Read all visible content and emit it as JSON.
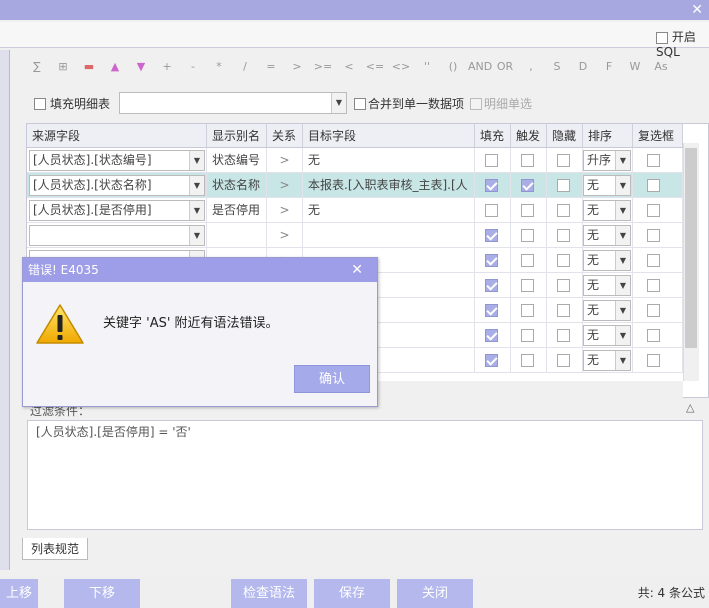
{
  "window": {
    "close_glyph": "✕"
  },
  "sql_toggle": {
    "label": "开启SQL"
  },
  "toolbar": {
    "buttons": [
      "sigma-icon",
      "table-add-icon",
      "table-remove-icon",
      "up-arrow-icon",
      "down-arrow-icon",
      "+",
      "-",
      "*",
      "/",
      "=",
      ">",
      ">=",
      "<",
      "<=",
      "<>",
      "''",
      "()",
      "AND",
      "OR",
      ",",
      "S",
      "D",
      "F",
      "W",
      "As"
    ]
  },
  "options": {
    "fill_detail": "填充明细表",
    "merge_single": "合并到单一数据项",
    "detail_single": "明细单选"
  },
  "grid": {
    "headers": [
      "来源字段",
      "显示别名",
      "关系",
      "目标字段",
      "填充",
      "触发",
      "隐藏",
      "排序",
      "复选框"
    ],
    "rows": [
      {
        "source": "[人员状态].[状态编号]",
        "alias": "状态编号",
        "rel": ">",
        "target": "无",
        "fill": false,
        "trigger": false,
        "hide": false,
        "sort": "升序",
        "check": false,
        "selected": false
      },
      {
        "source": "[人员状态].[状态名称]",
        "alias": "状态名称",
        "rel": ">",
        "target": "本报表.[入职表审核_主表].[人",
        "fill": true,
        "trigger": true,
        "hide": false,
        "sort": "无",
        "check": false,
        "selected": true
      },
      {
        "source": "[人员状态].[是否停用]",
        "alias": "是否停用",
        "rel": ">",
        "target": "无",
        "fill": false,
        "trigger": false,
        "hide": false,
        "sort": "无",
        "check": false,
        "selected": false
      },
      {
        "source": "",
        "alias": "",
        "rel": ">",
        "target": "",
        "fill": true,
        "trigger": false,
        "hide": false,
        "sort": "无",
        "check": false,
        "selected": false
      },
      {
        "source": "",
        "alias": "",
        "rel": ">",
        "target": "",
        "fill": true,
        "trigger": false,
        "hide": false,
        "sort": "无",
        "check": false,
        "selected": false
      },
      {
        "source": "",
        "alias": "",
        "rel": ">",
        "target": "",
        "fill": true,
        "trigger": false,
        "hide": false,
        "sort": "无",
        "check": false,
        "selected": false
      },
      {
        "source": "",
        "alias": "",
        "rel": ">",
        "target": "",
        "fill": true,
        "trigger": false,
        "hide": false,
        "sort": "无",
        "check": false,
        "selected": false
      },
      {
        "source": "",
        "alias": "",
        "rel": ">",
        "target": "",
        "fill": true,
        "trigger": false,
        "hide": false,
        "sort": "无",
        "check": false,
        "selected": false
      },
      {
        "source": "",
        "alias": "",
        "rel": ">",
        "target": "",
        "fill": true,
        "trigger": false,
        "hide": false,
        "sort": "无",
        "check": false,
        "selected": false
      }
    ]
  },
  "filter": {
    "label": "过滤条件：",
    "text": "[人员状态].[是否停用] = '否'"
  },
  "tabs": {
    "list_spec": "列表规范"
  },
  "buttons": {
    "up": "上移",
    "down": "下移",
    "check_syntax": "检查语法",
    "save": "保存",
    "close": "关闭"
  },
  "total": "共: 4 条公式",
  "dialog": {
    "title": "错误! E4035",
    "close_glyph": "✕",
    "message": "关键字 'AS' 附近有语法错误。",
    "ok": "确认"
  },
  "colors": {
    "accent": "#a4aaea",
    "selected_row": "#c8e6e6",
    "titlebar": "#a8a8e0"
  }
}
